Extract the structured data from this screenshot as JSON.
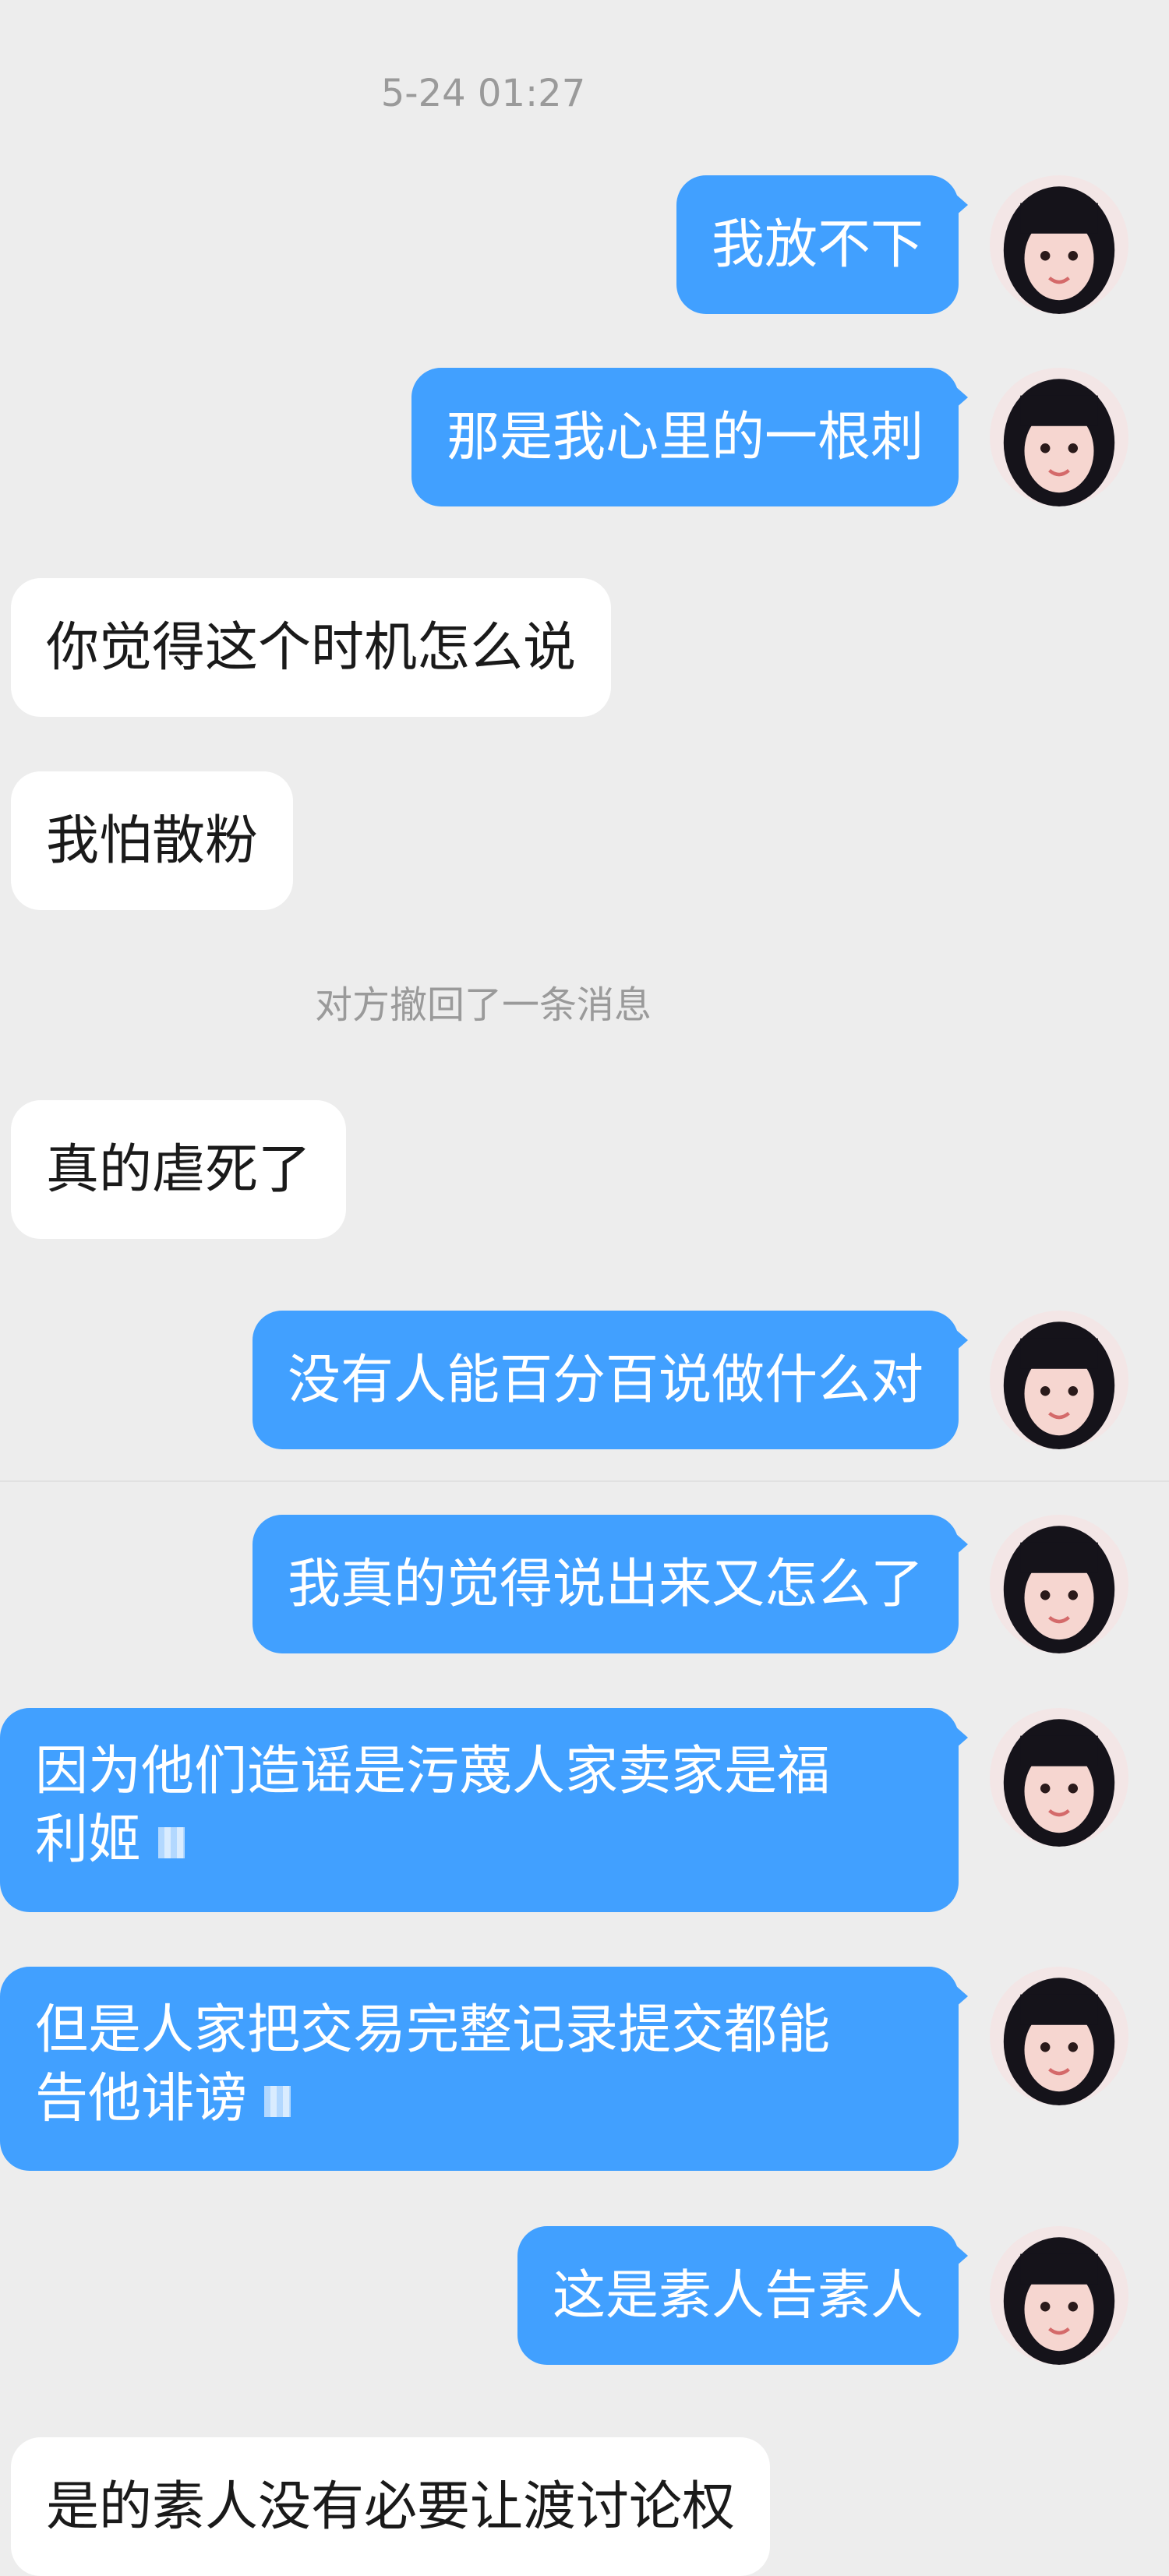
{
  "timestamp": "5-24 01:27",
  "system_messages": {
    "recalled": "对方撤回了一条消息"
  },
  "messages": [
    {
      "side": "out",
      "text": "我放不下"
    },
    {
      "side": "out",
      "text": "那是我心里的一根刺"
    },
    {
      "side": "in",
      "text": "你觉得这个时机怎么说"
    },
    {
      "side": "in",
      "text": "我怕散粉"
    },
    {
      "side": "in",
      "text": "真的虐死了"
    },
    {
      "side": "out",
      "text": "没有人能百分百说做什么对"
    },
    {
      "side": "out",
      "text": "我真的觉得说出来又怎么了"
    },
    {
      "side": "out",
      "text_line1": "因为他们造谣是污蔑人家卖家是福",
      "text_line2": "利姬"
    },
    {
      "side": "out",
      "text_line1": "但是人家把交易完整记录提交都能",
      "text_line2": "告他诽谤"
    },
    {
      "side": "out",
      "text": "这是素人告素人"
    },
    {
      "side": "in",
      "text": "是的素人没有必要让渡讨论权"
    }
  ],
  "avatar": {
    "icon": "user-avatar-girl",
    "hair_color": "#15131a",
    "skin_color": "#f6d6d0"
  },
  "colors": {
    "background": "#ededed",
    "outgoing_bubble": "#41a0ff",
    "incoming_bubble": "#ffffff",
    "system_text": "#9a9a9a"
  }
}
